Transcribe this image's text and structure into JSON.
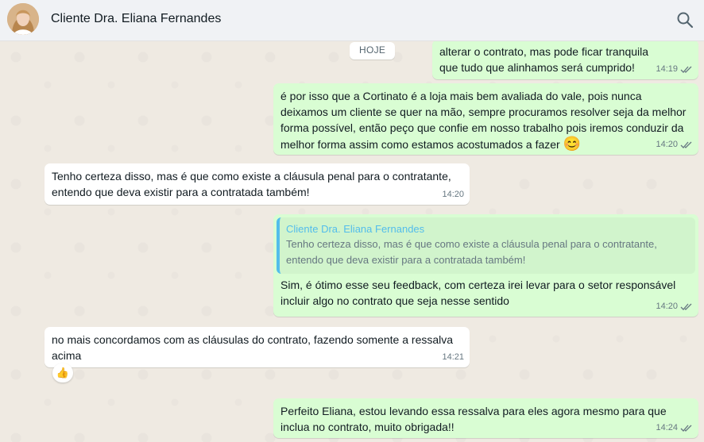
{
  "header": {
    "contact_name": "Cliente Dra. Eliana Fernandes",
    "search_icon": "search-icon"
  },
  "date_chip": "HOJE",
  "messages": [
    {
      "direction": "out",
      "text": "alterar o contrato, mas pode ficar tranquila que tudo que alinhamos será cumprido!",
      "time": "14:19",
      "status": "read"
    },
    {
      "direction": "out",
      "text": "é por isso que a Cortinato é a loja mais bem avaliada do vale, pois nunca deixamos um cliente se quer na mão, sempre procuramos resolver seja da melhor forma possível, então peço que confie em nosso trabalho pois iremos conduzir da melhor forma assim como estamos acostumados a fazer",
      "emoji": "😊",
      "time": "14:20",
      "status": "read"
    },
    {
      "direction": "in",
      "text": "Tenho certeza disso, mas é que como existe a cláusula penal para o contratante, entendo que deva existir para a contratada também!",
      "time": "14:20"
    },
    {
      "direction": "out",
      "quote": {
        "author": "Cliente Dra. Eliana Fernandes",
        "text": "Tenho certeza disso, mas é que como existe a cláusula penal para o contratante, entendo que deva existir para a contratada também!"
      },
      "text": "Sim, é ótimo esse seu feedback, com certeza irei levar para o setor responsável incluir algo no contrato que seja nesse sentido",
      "time": "14:20",
      "status": "read"
    },
    {
      "direction": "in",
      "text": "no mais concordamos com as cláusulas do contrato, fazendo somente a ressalva acima",
      "time": "14:21",
      "reaction": "👍"
    },
    {
      "direction": "out",
      "text": "Perfeito Eliana, estou levando essa ressalva para eles agora mesmo para que inclua no contrato, muito obrigada!!",
      "time": "14:24",
      "status": "read"
    }
  ],
  "colors": {
    "outgoing_bubble": "#d9fdd3",
    "incoming_bubble": "#ffffff",
    "read_ticks": "#667781",
    "quote_author": "#53bdeb"
  }
}
